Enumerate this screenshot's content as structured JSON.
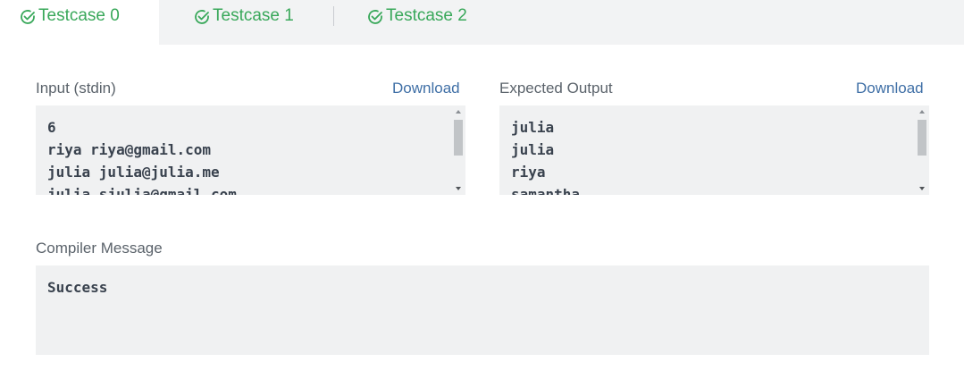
{
  "tabs": [
    {
      "label": "Testcase 0",
      "status_icon": "check-circle-icon",
      "active": true
    },
    {
      "label": "Testcase 1",
      "status_icon": "check-circle-icon",
      "active": false
    },
    {
      "label": "Testcase 2",
      "status_icon": "check-circle-icon",
      "active": false
    }
  ],
  "input": {
    "label": "Input (stdin)",
    "download_label": "Download",
    "content": "6\nriya riya@gmail.com\njulia julia@julia.me\njulia sjulia@gmail.com"
  },
  "expected_output": {
    "label": "Expected Output",
    "download_label": "Download",
    "content": "julia\njulia\nriya\nsamantha"
  },
  "compiler": {
    "label": "Compiler Message",
    "content": "Success"
  },
  "colors": {
    "success_green": "#39a85a",
    "link_blue": "#3f6fa6",
    "label_gray": "#5b636b",
    "box_bg": "#f0f1f2"
  }
}
